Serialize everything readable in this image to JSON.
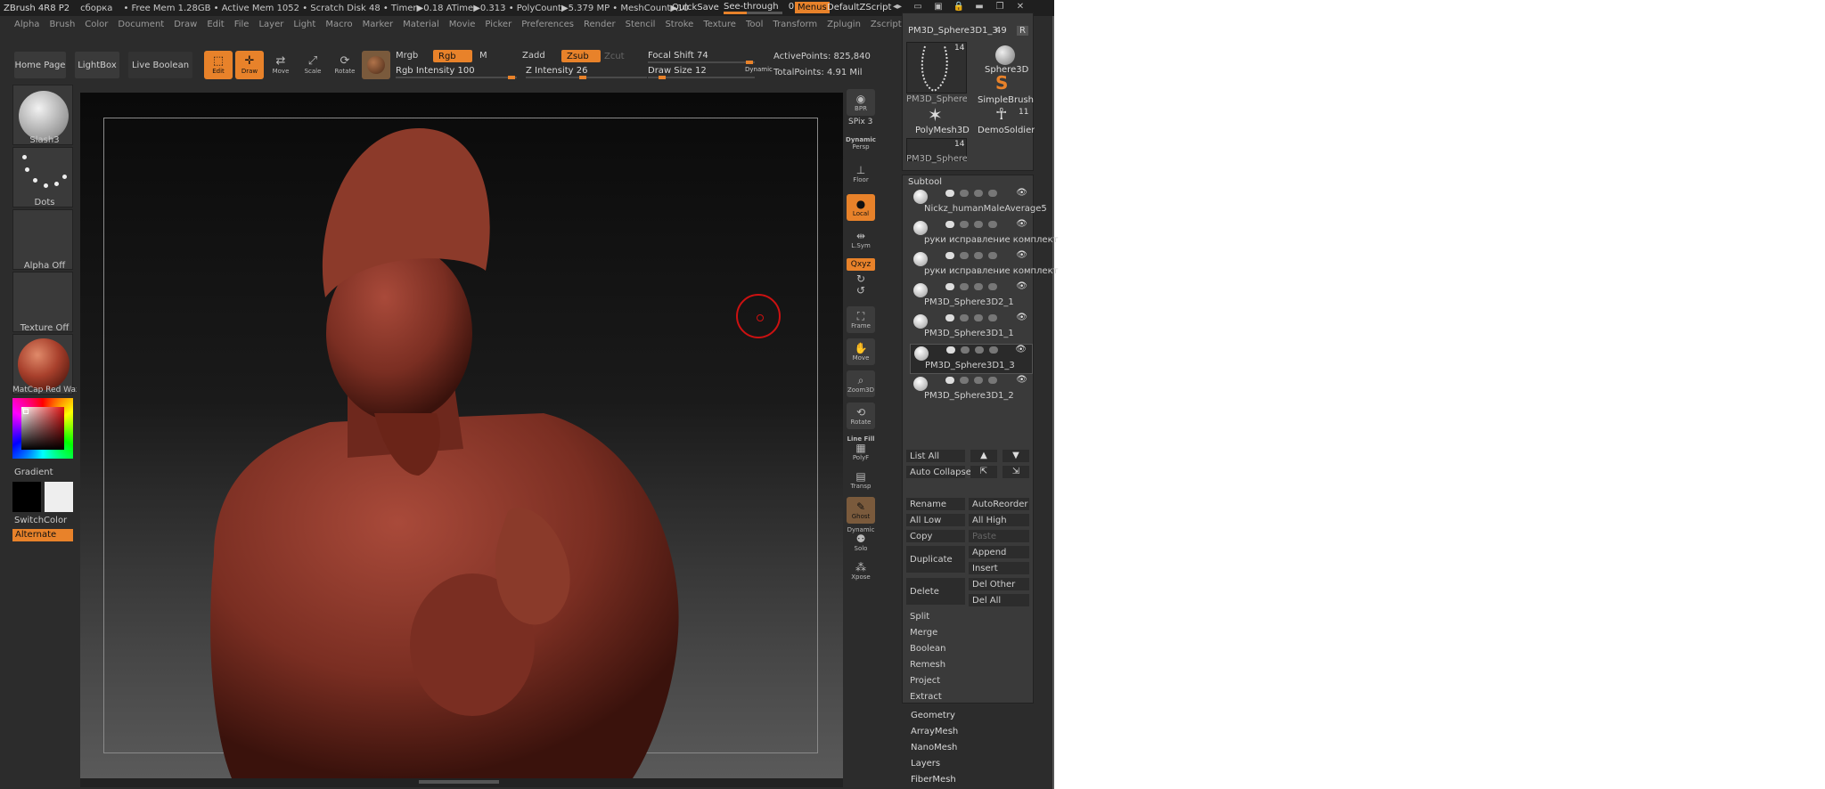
{
  "titlebar": {
    "app": "ZBrush 4R8 P2",
    "doc": "сборка",
    "stats": "• Free Mem 1.28GB • Active Mem 1052 • Scratch Disk 48 • Timer▶0.18 ATime▶0.313 • PolyCount▶5.379 MP • MeshCount▶10",
    "quicksave": "QuickSave",
    "seethrough_label": "See-through",
    "seethrough_value": "0",
    "seethrough_fraction": 0.4,
    "menus": "Menus",
    "defaultzscript": "DefaultZScript"
  },
  "menubar": [
    "Alpha",
    "Brush",
    "Color",
    "Document",
    "Draw",
    "Edit",
    "File",
    "Layer",
    "Light",
    "Macro",
    "Marker",
    "Material",
    "Movie",
    "Picker",
    "Preferences",
    "Render",
    "Stencil",
    "Stroke",
    "Texture",
    "Tool",
    "Transform",
    "Zplugin",
    "Zscript"
  ],
  "shelf": {
    "home": "Home Page",
    "lightbox": "LightBox",
    "liveboolean": "Live Boolean",
    "edit": "Edit",
    "draw": "Draw",
    "move": "Move",
    "scale": "Scale",
    "rotate": "Rotate",
    "mrgb": "Mrgb",
    "rgb": "Rgb",
    "m": "M",
    "zadd": "Zadd",
    "zsub": "Zsub",
    "zcut": "Zcut",
    "rgb_intensity_label": "Rgb Intensity",
    "rgb_intensity": "100",
    "z_intensity_label": "Z Intensity",
    "z_intensity": "26",
    "focal_shift_label": "Focal Shift",
    "focal_shift": "74",
    "draw_size_label": "Draw Size",
    "draw_size": "12",
    "dynamic": "Dynamic",
    "active_points": "ActivePoints: 825,840",
    "total_points": "TotalPoints: 4.91 Mil"
  },
  "lefttray": {
    "brush": "Slash3",
    "stroke": "Dots",
    "alpha": "Alpha Off",
    "texture": "Texture Off",
    "material": "MatCap Red Wax",
    "gradient": "Gradient",
    "switchcolor": "SwitchColor",
    "alternate": "Alternate"
  },
  "rightshelf": {
    "bpr": "BPR",
    "spix_label": "SPix",
    "spix": "3",
    "dynamic": "Dynamic",
    "persp": "Persp",
    "floor": "Floor",
    "local": "Local",
    "lsym": "L.Sym",
    "xyz": "Qxyz",
    "frame": "Frame",
    "move": "Move",
    "zoom3d": "Zoom3D",
    "rotate": "Rotate",
    "linefill": "Line Fill",
    "polyf": "PolyF",
    "transp": "Transp",
    "ghost": "Ghost",
    "dynamic2": "Dynamic",
    "solo": "Solo",
    "xpose": "Xpose"
  },
  "tool": {
    "current": "PM3D_Sphere3D1_3.",
    "current_value": "49",
    "r": "R",
    "thumbs": [
      {
        "name": "PM3D_Sphere3D",
        "count": "14"
      },
      {
        "name": "Sphere3D",
        "count": ""
      },
      {
        "name": "SimpleBrush",
        "count": ""
      },
      {
        "name": "PolyMesh3D",
        "count": ""
      },
      {
        "name": "DemoSoldier",
        "count": "11"
      },
      {
        "name": "PM3D_Sphere3D",
        "count": "14"
      }
    ]
  },
  "subtool": {
    "header": "Subtool",
    "items": [
      "Nickz_humanMaleAverage5",
      "руки исправление комплект",
      "руки исправление комплект",
      "PM3D_Sphere3D2_1",
      "PM3D_Sphere3D1_1",
      "PM3D_Sphere3D1_3",
      "PM3D_Sphere3D1_2"
    ],
    "listall": "List All",
    "autocollapse": "Auto Collapse",
    "rename": "Rename",
    "autoreorder": "AutoReorder",
    "alllow": "All Low",
    "allhigh": "All High",
    "copy": "Copy",
    "paste": "Paste",
    "duplicate": "Duplicate",
    "append": "Append",
    "insert": "Insert",
    "delete": "Delete",
    "delother": "Del Other",
    "delall": "Del All",
    "split": "Split",
    "merge": "Merge",
    "boolean": "Boolean",
    "remesh": "Remesh",
    "project": "Project",
    "extract": "Extract"
  },
  "subpanels": [
    "Geometry",
    "ArrayMesh",
    "NanoMesh",
    "Layers",
    "FiberMesh"
  ],
  "colors": {
    "accent": "#e8822a",
    "clay": "#8a3a2e"
  }
}
